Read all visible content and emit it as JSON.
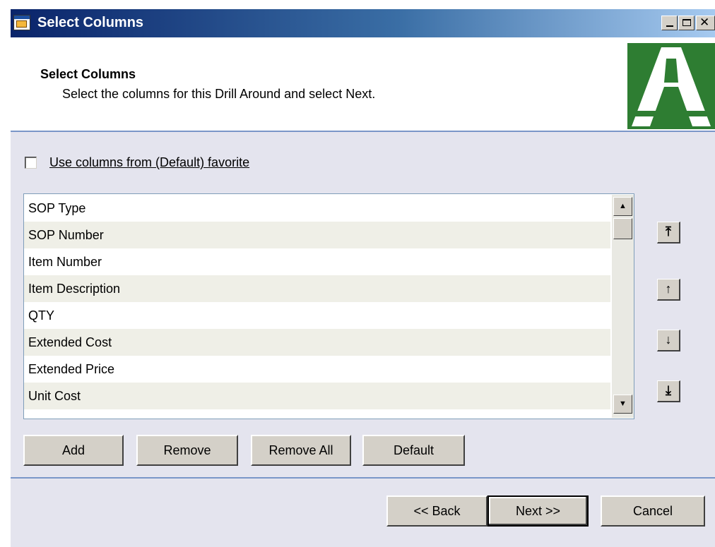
{
  "window": {
    "title": "Select Columns",
    "controls": [
      "minimize-icon",
      "maximize-icon",
      "close-icon"
    ]
  },
  "header": {
    "title": "Select Columns",
    "subtitle": "Select the columns for this Drill Around and select Next.",
    "logo_colors": [
      "#2e7d32",
      "#ffffff"
    ]
  },
  "favorite_checkbox": {
    "label": "Use columns from (Default) favorite",
    "checked": false
  },
  "columns_list": {
    "items": [
      "SOP Type",
      "SOP Number",
      "Item Number",
      "Item Description",
      "QTY",
      "Extended Cost",
      "Extended Price",
      "Unit Cost"
    ]
  },
  "move_buttons": {
    "top": "⤒",
    "up": "↑",
    "down": "↓",
    "bottom": "⤓"
  },
  "action_buttons": {
    "add": "Add",
    "remove": "Remove",
    "remove_all": "Remove All",
    "default": "Default"
  },
  "nav_buttons": {
    "back": "<< Back",
    "next": "Next >>",
    "cancel": "Cancel"
  }
}
